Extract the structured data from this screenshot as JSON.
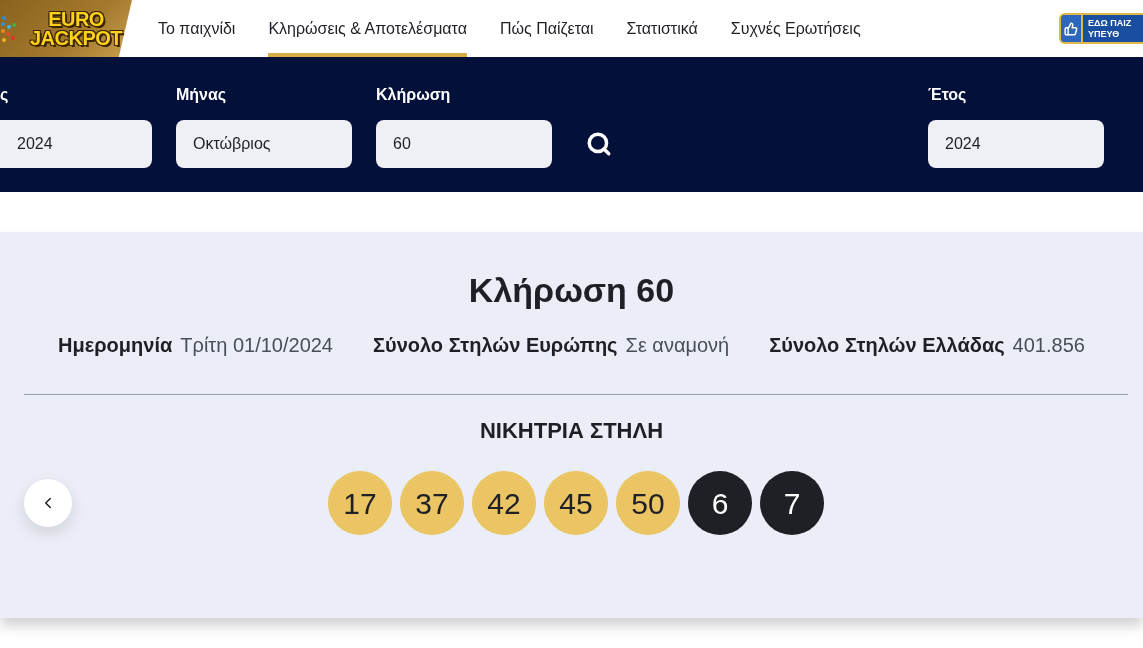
{
  "header": {
    "logo": {
      "lines": [
        "EURO",
        "JACKPOT"
      ]
    },
    "nav": [
      {
        "label": "Το παιχνίδι",
        "selected": false
      },
      {
        "label": "Κληρώσεις & Αποτελέσματα",
        "selected": true
      },
      {
        "label": "Πώς Παίζεται",
        "selected": false
      },
      {
        "label": "Στατιστικά",
        "selected": false
      },
      {
        "label": "Συχνές Ερωτήσεις",
        "selected": false
      }
    ],
    "badge": {
      "lines": [
        "ΕΔΩ ΠΑΙΖ",
        "ΥΠΕΥΘ"
      ]
    }
  },
  "filters": {
    "left_group": [
      {
        "label": "ς",
        "value": "2024"
      },
      {
        "label": "Μήνας",
        "value": "Οκτώβριος"
      },
      {
        "label": "Κλήρωση",
        "value": "60"
      }
    ],
    "right_group": [
      {
        "label": "Έτος",
        "value": "2024"
      }
    ]
  },
  "draw": {
    "title": "Κλήρωση 60",
    "details": [
      {
        "label": "Ημερομηνία",
        "value": "Τρίτη 01/10/2024"
      },
      {
        "label": "Σύνολο Στηλών Ευρώπης",
        "value": "Σε αναμονή"
      },
      {
        "label": "Σύνολο Στηλών Ελλάδας",
        "value": "401.856"
      }
    ],
    "winning_heading": "ΝΙΚΗΤΡΙΑ ΣΤΗΛΗ",
    "balls": [
      {
        "number": "17",
        "kind": "main"
      },
      {
        "number": "37",
        "kind": "main"
      },
      {
        "number": "42",
        "kind": "main"
      },
      {
        "number": "45",
        "kind": "main"
      },
      {
        "number": "50",
        "kind": "main"
      },
      {
        "number": "6",
        "kind": "euro"
      },
      {
        "number": "7",
        "kind": "euro"
      }
    ]
  }
}
